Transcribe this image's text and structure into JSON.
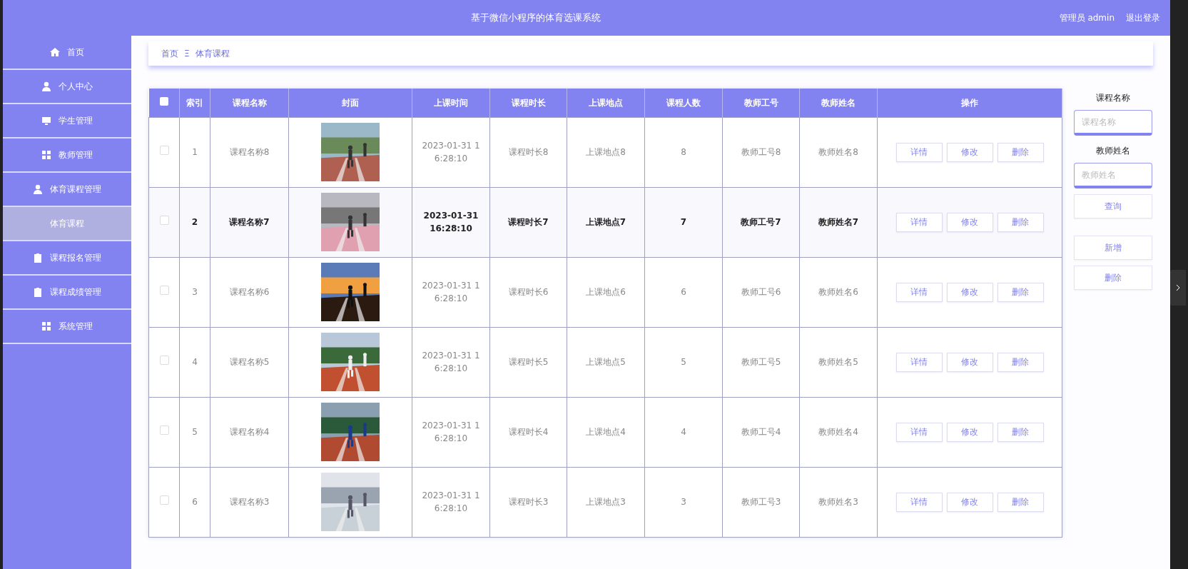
{
  "header": {
    "title": "基于微信小程序的体育选课系统",
    "user": "管理员 admin",
    "logout": "退出登录"
  },
  "sidebar": {
    "items": [
      {
        "label": "首页",
        "selected": false
      },
      {
        "label": "个人中心",
        "selected": false
      },
      {
        "label": "学生管理",
        "selected": false
      },
      {
        "label": "教师管理",
        "selected": false
      },
      {
        "label": "体育课程管理",
        "selected": false,
        "children": [
          {
            "label": "体育课程",
            "selected": true
          }
        ]
      },
      {
        "label": "课程报名管理",
        "selected": false
      },
      {
        "label": "课程成绩管理",
        "selected": false
      },
      {
        "label": "系统管理",
        "selected": false
      }
    ]
  },
  "breadcrumb": {
    "home": "首页",
    "separator": "Ξ",
    "current": "体育课程"
  },
  "table": {
    "columns": [
      "索引",
      "课程名称",
      "封面",
      "上课时间",
      "课程时长",
      "上课地点",
      "课程人数",
      "教师工号",
      "教师姓名",
      "操作"
    ],
    "header_checked": false,
    "rows": [
      {
        "index": "1",
        "name": "课程名称8",
        "time": "2023-01-31 16:28:10",
        "duration": "课程时长8",
        "place": "上课地点8",
        "count": "8",
        "teacher_no": "教师工号8",
        "teacher": "教师姓名8",
        "checked": false,
        "hovered": false,
        "actions": [
          "详情",
          "修改",
          "删除"
        ]
      },
      {
        "index": "2",
        "name": "课程名称7",
        "time": "2023-01-31 16:28:10",
        "duration": "课程时长7",
        "place": "上课地点7",
        "count": "7",
        "teacher_no": "教师工号7",
        "teacher": "教师姓名7",
        "checked": false,
        "hovered": true,
        "actions": [
          "详情",
          "修改",
          "删除"
        ]
      },
      {
        "index": "3",
        "name": "课程名称6",
        "time": "2023-01-31 16:28:10",
        "duration": "课程时长6",
        "place": "上课地点6",
        "count": "6",
        "teacher_no": "教师工号6",
        "teacher": "教师姓名6",
        "checked": false,
        "hovered": false,
        "actions": [
          "详情",
          "修改",
          "删除"
        ]
      },
      {
        "index": "4",
        "name": "课程名称5",
        "time": "2023-01-31 16:28:10",
        "duration": "课程时长5",
        "place": "上课地点5",
        "count": "5",
        "teacher_no": "教师工号5",
        "teacher": "教师姓名5",
        "checked": false,
        "hovered": false,
        "actions": [
          "详情",
          "修改",
          "删除"
        ]
      },
      {
        "index": "5",
        "name": "课程名称4",
        "time": "2023-01-31 16:28:10",
        "duration": "课程时长4",
        "place": "上课地点4",
        "count": "4",
        "teacher_no": "教师工号4",
        "teacher": "教师姓名4",
        "checked": false,
        "hovered": false,
        "actions": [
          "详情",
          "修改",
          "删除"
        ]
      },
      {
        "index": "6",
        "name": "课程名称3",
        "time": "2023-01-31 16:28:10",
        "duration": "课程时长3",
        "place": "上课地点3",
        "count": "3",
        "teacher_no": "教师工号3",
        "teacher": "教师姓名3",
        "checked": false,
        "hovered": false,
        "actions": [
          "详情",
          "修改",
          "删除"
        ]
      }
    ]
  },
  "search": {
    "fields": [
      {
        "label": "课程名称",
        "placeholder": "课程名称"
      },
      {
        "label": "教师姓名",
        "placeholder": "教师姓名"
      }
    ],
    "query": "查询",
    "buttons": [
      "新增",
      "删除"
    ]
  }
}
